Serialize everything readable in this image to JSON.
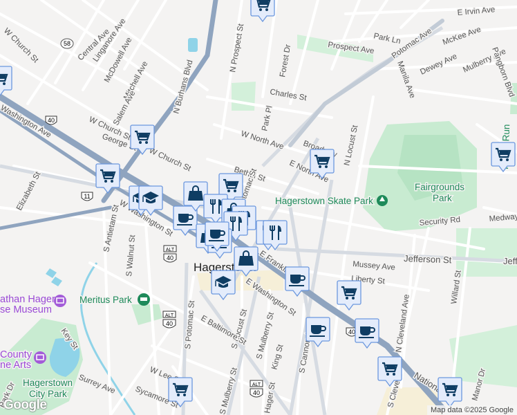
{
  "map": {
    "streets": {
      "w_church_st_nw": "W Church St",
      "central_ave": "Central Ave",
      "linganore_ave": "Linganore Ave",
      "mcdowell_ave": "McDowell Ave",
      "mitchell_ave": "Mitchell Ave",
      "salem_ave": "Salem Ave",
      "n_burhans_blvd": "N Burhans Blvd",
      "n_prospect_st": "N Prospect St",
      "forest_dr": "Forest Dr",
      "charles_st": "Charles St",
      "park_pl": "Park Pl",
      "w_north_ave": "W North Ave",
      "bethel_st": "Bethel St",
      "e_north_ave": "E North Ave",
      "broadway": "Broadway",
      "n_locust_st": "N Locust St",
      "potomac_ave": "Potomac Ave",
      "prospect_ave": "Prospect Ave",
      "park_ln": "Park Ln",
      "e_irvin_ave": "E Irvin Ave",
      "mckee_ave": "McKee Ave",
      "dewey_ave": "Dewey Ave",
      "mulberry_ave": "Mulberry Ave",
      "manila_ave": "Manila Ave",
      "pangborn_blvd": "Pangborn Blvd",
      "w_church_st": "W Church St",
      "w_church_st2": "W Church St",
      "george_st": "George St",
      "washington_ave": "Washington Ave",
      "elizabeth_st": "Elizabeth St",
      "w_washington_st": "W Washington St",
      "s_antietam_st": "S Antietam St",
      "s_walnut_st": "S Walnut St",
      "s_potomac_st": "S Potomac St",
      "s_locust_st": "S Locust St",
      "e_washington_st": "E Washington St",
      "e_franklin_st": "E Franklin St",
      "s_mulberry_st": "S Mulberry St",
      "king_st": "King St",
      "e_baltimore_st": "E Baltimore St",
      "s_cannon_ave": "S Cannon Ave",
      "mussey_ave": "Mussey Ave",
      "liberty_st": "Liberty St",
      "jefferson_st": "Jefferson St",
      "jefferson_st2": "Jeff",
      "security_rd": "Security Rd",
      "medway": "Medway",
      "n_cleveland_ave": "N Cleveland Ave",
      "willard_st": "Willard St",
      "s_cleveland": "S Clevela",
      "national_pike": "National",
      "manor_dr": "Manor Dr",
      "key_st": "Key St",
      "surrey_ave": "Surrey Ave",
      "w_lee_st": "W Lee St",
      "sycamore_st": "Sycamore St",
      "s_mulberry_st2": "S Mulberry St",
      "hager_st": "Hager St",
      "park_dr": "Park Dr",
      "n_potomac": "N Potomac St"
    },
    "shields": {
      "us40": "40",
      "us11": "11",
      "alt": "ALT",
      "md58": "58"
    },
    "places": {
      "city": "Hagerstown",
      "skate_park": "Hagerstown Skate Park",
      "fairgrounds_1": "Fairgrounds",
      "fairgrounds_2": "Park",
      "meritus_park": "Meritus Park",
      "museum_1": "athan Hager",
      "museum_2": "se Museum",
      "arts_1": "County",
      "arts_2": "ne Arts",
      "city_park_1": "Hagerstown",
      "city_park_2": "City Park",
      "hager_run": "Hager Run"
    },
    "colors": {
      "marker_bg": "#e4ecfb",
      "marker_border": "#6b97de",
      "marker_icon": "#0f3d63",
      "highway": "#8fa4bf",
      "park": "#c9ecd2"
    },
    "markers": [
      "cart",
      "cart",
      "cart",
      "cart",
      "school",
      "school",
      "coffee",
      "bag",
      "cart",
      "fork",
      "bag",
      "fork",
      "fork",
      "bag",
      "coffee",
      "coffee",
      "bag",
      "fork",
      "fork",
      "school",
      "coffee",
      "cart",
      "cart",
      "cart",
      "coffee",
      "coffee",
      "cart",
      "cart",
      "cart"
    ]
  },
  "footer": {
    "logo": "Google",
    "attribution": "Map data ©2025 Google"
  }
}
